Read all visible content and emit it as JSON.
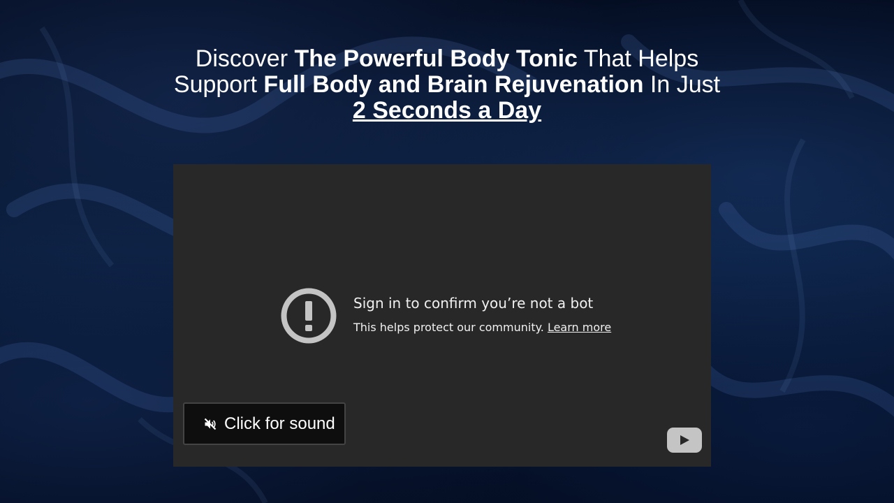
{
  "headline": {
    "part1": "Discover ",
    "part2": "The Powerful Body Tonic",
    "part3": " That Helps Support ",
    "part4": "Full Body and Brain Rejuvenation",
    "part5": " In Just ",
    "part6": "2 Seconds a Day"
  },
  "video": {
    "error_icon": "exclamation-circle-icon",
    "error_title": "Sign in to confirm you’re not a bot",
    "error_text": "This helps protect our community. ",
    "learn_more": "Learn more",
    "sound_button_icon": "mute-speaker-icon",
    "sound_button_label": "Click for sound",
    "logo_icon": "youtube-play-icon"
  },
  "colors": {
    "player_bg": "#282828",
    "text": "#ffffff",
    "button_bg": "#0e0e0e"
  }
}
